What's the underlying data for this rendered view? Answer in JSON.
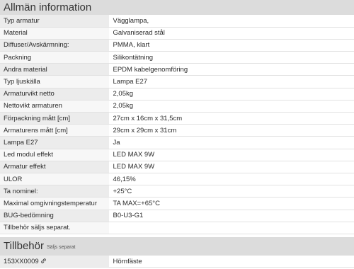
{
  "general": {
    "title": "Allmän information",
    "rows": [
      {
        "label": "Typ armatur",
        "value": "Vägglampa,"
      },
      {
        "label": "Material",
        "value": "Galvaniserad stål"
      },
      {
        "label": "Diffuser/Avskärmning:",
        "value": "PMMA, klart"
      },
      {
        "label": "Packning",
        "value": "Silikontätning"
      },
      {
        "label": "Andra material",
        "value": "EPDM kabelgenomföring"
      },
      {
        "label": "Typ ljuskälla",
        "value": "Lampa E27"
      },
      {
        "label": "Armaturvikt netto",
        "value": "2,05kg"
      },
      {
        "label": "Nettovikt armaturen",
        "value": "2,05kg"
      },
      {
        "label": "Förpackning mått [cm]",
        "value": "27cm x 16cm x 31,5cm"
      },
      {
        "label": "Armaturens mått [cm]",
        "value": "29cm x 29cm x 31cm"
      },
      {
        "label": "Lampa E27",
        "value": "Ja"
      },
      {
        "label": "Led modul effekt",
        "value": "LED MAX 9W"
      },
      {
        "label": "Armatur effekt",
        "value": "LED MAX 9W"
      },
      {
        "label": "ULOR",
        "value": "46,15%"
      },
      {
        "label": "Ta nominel:",
        "value": "+25°C"
      },
      {
        "label": "Maximal omgivningstemperatur",
        "value": "TA MAX=+65°C"
      },
      {
        "label": "BUG-bedömning",
        "value": "B0-U3-G1"
      },
      {
        "label": "Tillbehör säljs separat.",
        "value": ""
      }
    ]
  },
  "accessories": {
    "title": "Tillbehör",
    "subtitle": "Säljs separat",
    "rows": [
      {
        "code": "153XX0009",
        "name": "Hörnfäste",
        "icon": "link-icon"
      }
    ]
  }
}
